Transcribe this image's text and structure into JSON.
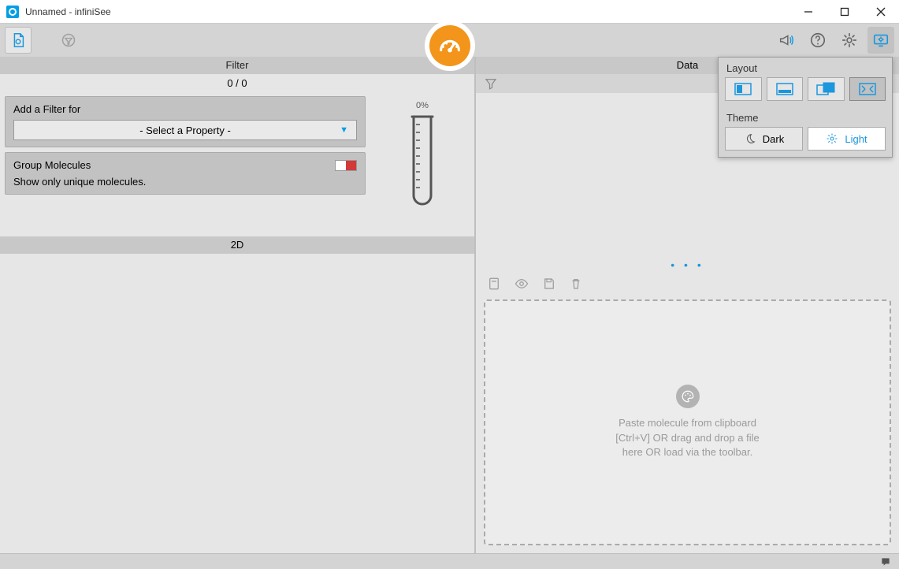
{
  "window": {
    "title": "Unnamed - infiniSee"
  },
  "left": {
    "filter_header": "Filter",
    "count": "0 / 0",
    "add_filter_label": "Add a Filter for",
    "select_placeholder": "- Select a Property -",
    "group_label": "Group Molecules",
    "group_sub": "Show only unique molecules.",
    "tube_pct": "0%",
    "twod_header": "2D"
  },
  "right": {
    "data_header": "Data",
    "drop_text": "Paste molecule from clipboard [Ctrl+V] OR drag and drop a file here OR load via the toolbar."
  },
  "popover": {
    "layout_title": "Layout",
    "theme_title": "Theme",
    "dark_label": "Dark",
    "light_label": "Light"
  }
}
